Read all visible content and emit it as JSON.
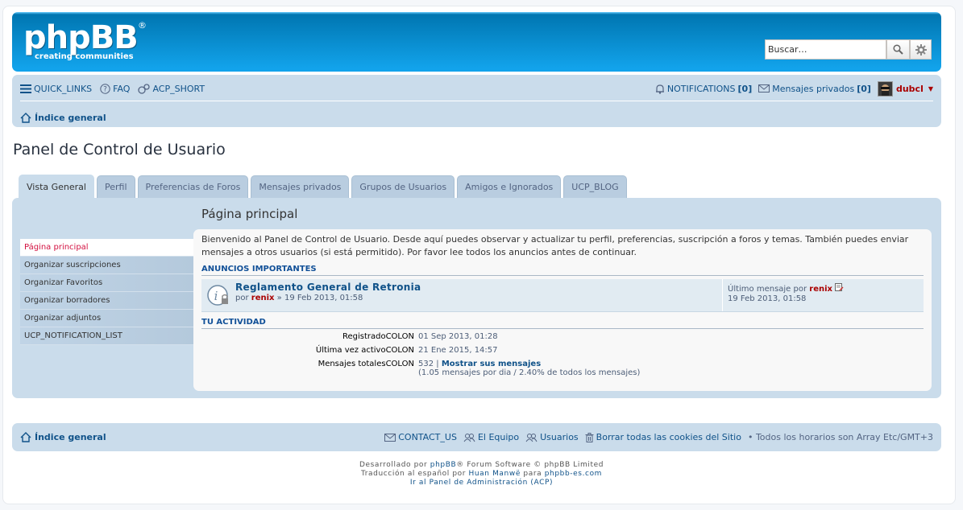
{
  "logo": {
    "text": "phpBB",
    "reg": "®",
    "tagline": "creating   communities"
  },
  "search": {
    "placeholder": "Buscar…"
  },
  "nav": {
    "quick_links": "QUICK_LINKS",
    "faq": "FAQ",
    "acp": "ACP_SHORT",
    "notifications": "NOTIFICATIONS",
    "notifications_count": "[0]",
    "pm": "Mensajes privados",
    "pm_count": "[0]",
    "username": "dubcl",
    "crumb": "Índice general"
  },
  "page_title": "Panel de Control de Usuario",
  "tabs": [
    "Vista General",
    "Perfil",
    "Preferencias de Foros",
    "Mensajes privados",
    "Grupos de Usuarios",
    "Amigos e Ignorados",
    "UCP_BLOG"
  ],
  "menu": [
    "Página principal",
    "Organizar suscripciones",
    "Organizar Favoritos",
    "Organizar borradores",
    "Organizar adjuntos",
    "UCP_NOTIFICATION_LIST"
  ],
  "content": {
    "title": "Página principal",
    "intro": "Bienvenido al Panel de Control de Usuario. Desde aquí puedes observar y actualizar tu perfil, preferencias, suscripción a foros y temas. También puedes enviar mensajes a otros usuarios (si está permitido). Por favor lee todos los anuncios antes de continuar.",
    "announce_head": "ANUNCIOS IMPORTANTES",
    "topic_title": "Reglamento General de Retronia",
    "topic_by": "por",
    "topic_author": "renix",
    "topic_date": "» 19 Feb 2013, 01:58",
    "last_label": "Último mensaje por",
    "last_author": "renix",
    "last_date": "19 Feb 2013, 01:58",
    "activity_head": "TU ACTIVIDAD",
    "activity": [
      {
        "k": "RegistradoCOLON",
        "v": "01 Sep 2013, 01:28"
      },
      {
        "k": "Última vez activoCOLON",
        "v": "21 Ene 2015, 14:57"
      },
      {
        "k": "Mensajes totalesCOLON",
        "v": "532 |",
        "link": "Mostrar sus mensajes",
        "sub": "(1.05 mensajes por dia / 2.40% de todos los mensajes)"
      }
    ]
  },
  "footer": {
    "home": "Índice general",
    "contact": "CONTACT_US",
    "team": "El Equipo",
    "users": "Usuarios",
    "cookies": "Borrar todas las cookies del Sitio",
    "tz": "• Todos los horarios son Array Etc/GMT+3",
    "line1_pre": "Desarrollado por",
    "line1_link": "phpBB",
    "line1_post": "® Forum Software © phpBB Limited",
    "line2_pre": "Traducción al español por",
    "line2_link1": "Huan Manwë",
    "line2_mid": "para",
    "line2_link2": "phpbb-es.com",
    "line3": "Ir al Panel de Administración (ACP)"
  }
}
